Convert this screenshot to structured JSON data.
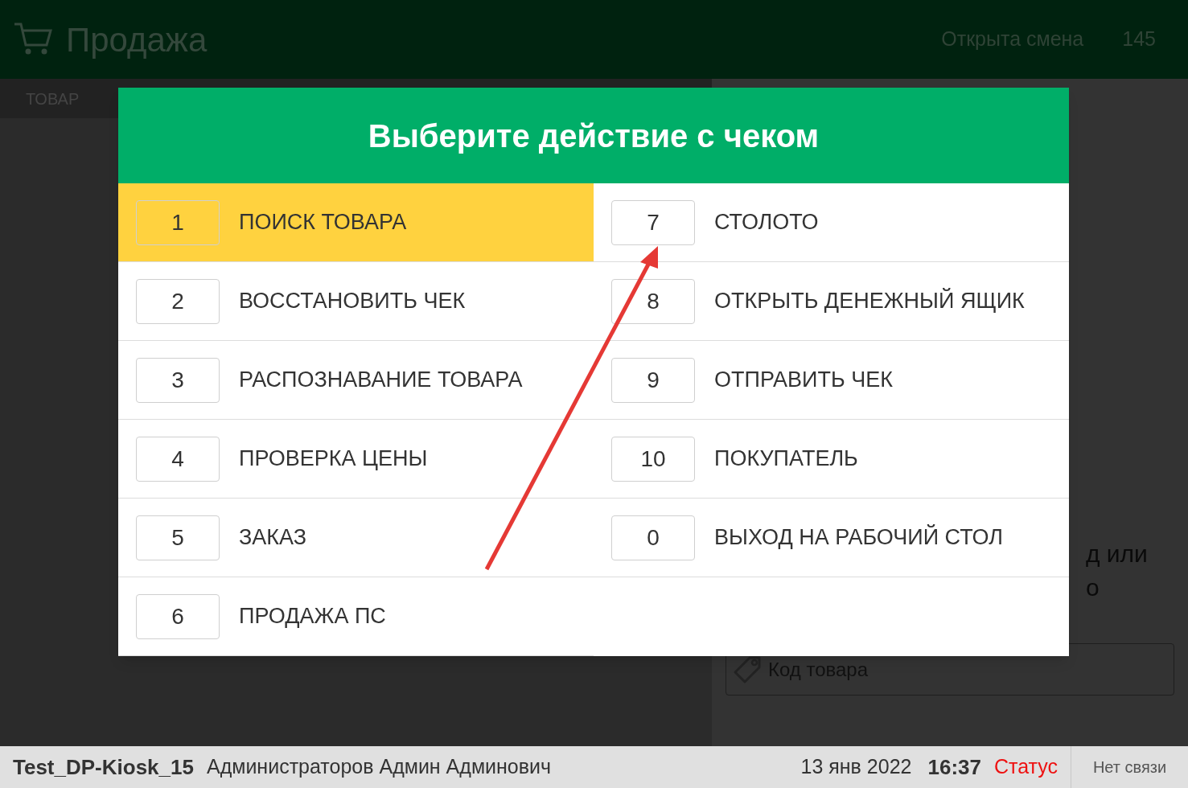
{
  "header": {
    "title": "Продажа",
    "shift_status": "Открыта смена",
    "shift_number": "145"
  },
  "left_panel": {
    "tab_label": "ТОВАР"
  },
  "right_panel": {
    "hint_fragments": [
      "д или",
      "о"
    ],
    "code_field": {
      "placeholder": "Код товара"
    }
  },
  "dialog": {
    "title": "Выберите действие с чеком",
    "left_column": [
      {
        "key": "1",
        "label": "ПОИСК ТОВАРА",
        "selected": true
      },
      {
        "key": "2",
        "label": "ВОССТАНОВИТЬ ЧЕК",
        "selected": false
      },
      {
        "key": "3",
        "label": "РАСПОЗНАВАНИЕ ТОВАРА",
        "selected": false
      },
      {
        "key": "4",
        "label": "ПРОВЕРКА ЦЕНЫ",
        "selected": false
      },
      {
        "key": "5",
        "label": "ЗАКАЗ",
        "selected": false
      },
      {
        "key": "6",
        "label": "ПРОДАЖА ПС",
        "selected": false
      }
    ],
    "right_column": [
      {
        "key": "7",
        "label": "СТОЛОТО",
        "selected": false
      },
      {
        "key": "8",
        "label": "ОТКРЫТЬ ДЕНЕЖНЫЙ ЯЩИК",
        "selected": false
      },
      {
        "key": "9",
        "label": "ОТПРАВИТЬ ЧЕК",
        "selected": false
      },
      {
        "key": "10",
        "label": "ПОКУПАТЕЛЬ",
        "selected": false
      },
      {
        "key": "0",
        "label": "ВЫХОД НА РАБОЧИЙ СТОЛ",
        "selected": false
      }
    ]
  },
  "status_bar": {
    "terminal": "Test_DP-Kiosk_15",
    "user": "Администраторов Админ Админович",
    "date": "13 янв 2022",
    "time": "16:37",
    "status": "Статус",
    "connection": "Нет связи"
  }
}
